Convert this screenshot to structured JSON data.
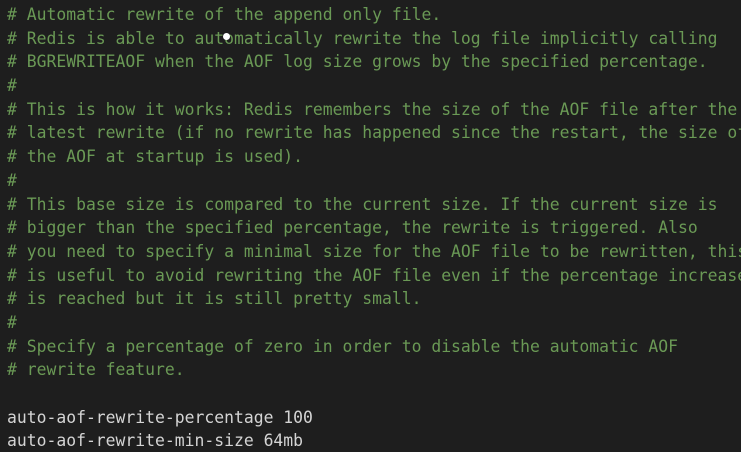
{
  "editor": {
    "lines": [
      "# Automatic rewrite of the append only file.",
      "# Redis is able to automatically rewrite the log file implicitly calling",
      "# BGREWRITEAOF when the AOF log size grows by the specified percentage.",
      "#",
      "# This is how it works: Redis remembers the size of the AOF file after the",
      "# latest rewrite (if no rewrite has happened since the restart, the size of",
      "# the AOF at startup is used).",
      "#",
      "# This base size is compared to the current size. If the current size is",
      "# bigger than the specified percentage, the rewrite is triggered. Also",
      "# you need to specify a minimal size for the AOF file to be rewritten, this",
      "# is useful to avoid rewriting the AOF file even if the percentage increase",
      "# is reached but it is still pretty small.",
      "#",
      "# Specify a percentage of zero in order to disable the automatic AOF",
      "# rewrite feature.",
      "",
      "auto-aof-rewrite-percentage 100",
      "auto-aof-rewrite-min-size 64mb"
    ]
  }
}
